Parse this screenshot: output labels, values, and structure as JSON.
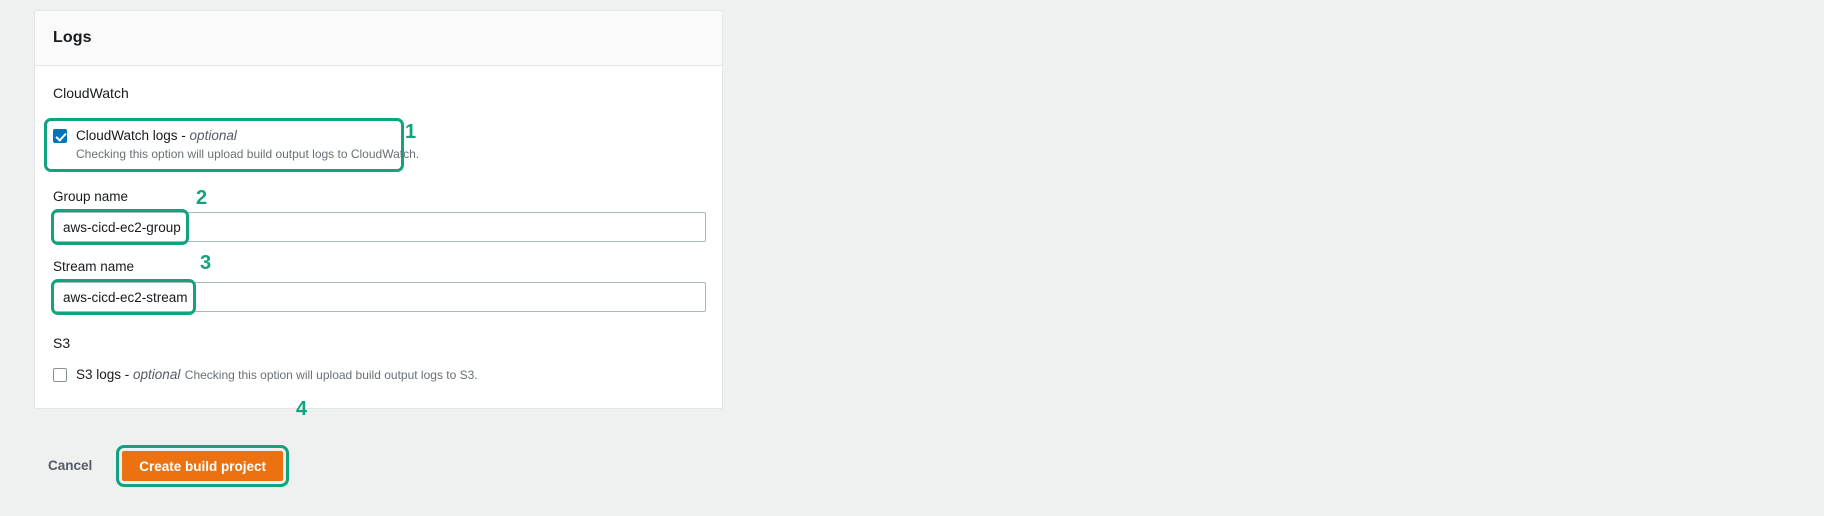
{
  "card": {
    "title": "Logs"
  },
  "cloudwatch": {
    "section_label": "CloudWatch",
    "checkbox": {
      "label": "CloudWatch logs",
      "separator": " - ",
      "optional": "optional",
      "description": "Checking this option will upload build output logs to CloudWatch.",
      "checked": true
    },
    "group_name": {
      "label": "Group name",
      "value": "aws-cicd-ec2-group",
      "placeholder": ""
    },
    "stream_name": {
      "label": "Stream name",
      "value": "aws-cicd-ec2-stream",
      "placeholder": ""
    }
  },
  "s3": {
    "section_label": "S3",
    "checkbox": {
      "label": "S3 logs",
      "separator": " - ",
      "optional": "optional",
      "description": "Checking this option will upload build output logs to S3.",
      "checked": false
    }
  },
  "actions": {
    "cancel_label": "Cancel",
    "create_label": "Create build project"
  },
  "annotations": {
    "step1": "1",
    "step2": "2",
    "step3": "3",
    "step4": "4"
  },
  "colors": {
    "highlight": "#12a37e",
    "primary_button": "#ec7211",
    "checkbox_checked": "#0073bb"
  }
}
